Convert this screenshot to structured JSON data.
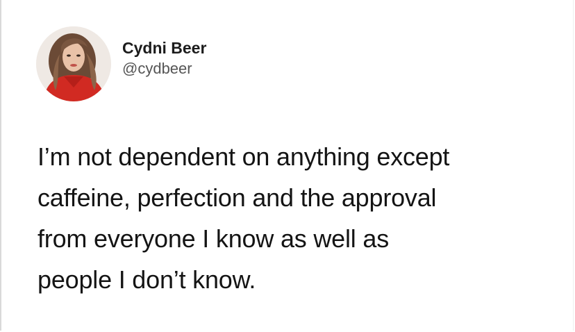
{
  "tweet": {
    "author": {
      "display_name": "Cydni Beer",
      "handle": "@cydbeer"
    },
    "text_lines": [
      "I’m not dependent on anything except",
      "caffeine, perfection and the approval",
      "from everyone I know as well as",
      "people I don’t know."
    ]
  }
}
